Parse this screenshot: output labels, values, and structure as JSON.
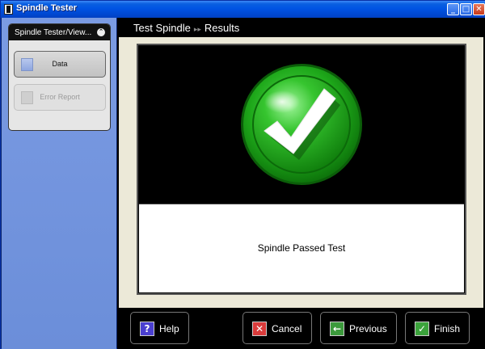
{
  "window": {
    "title": "Spindle Tester",
    "minimize_glyph": "_",
    "maximize_glyph": "□",
    "close_glyph": "✕"
  },
  "task_panel": {
    "title": "Spindle  Tester/View...",
    "collapse_glyph": "⌃",
    "items": [
      {
        "label": "Data",
        "enabled": true
      },
      {
        "label": "Error Report",
        "enabled": false
      }
    ]
  },
  "breadcrumb": {
    "step1": "Test Spindle",
    "separator": "▸▸",
    "step2": "Results"
  },
  "result": {
    "icon": "green-checkmark-icon",
    "message": "Spindle Passed Test",
    "status_color": "#17a10f"
  },
  "buttons": {
    "help": {
      "label": "Help",
      "icon": "question-icon",
      "glyph": "?"
    },
    "cancel": {
      "label": "Cancel",
      "icon": "x-icon",
      "glyph": "✕"
    },
    "previous": {
      "label": "Previous",
      "icon": "arrow-left-icon",
      "glyph": "←"
    },
    "finish": {
      "label": "Finish",
      "icon": "checkmark-icon",
      "glyph": "✓"
    }
  }
}
